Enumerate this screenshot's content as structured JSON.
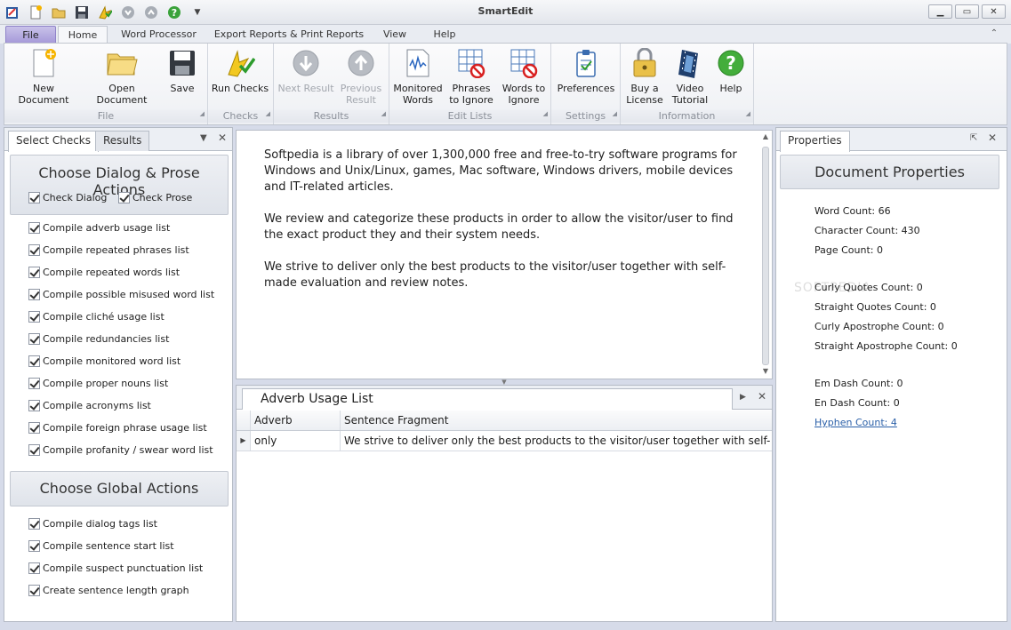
{
  "window": {
    "title": "SmartEdit"
  },
  "qat": {
    "icons": [
      "app-icon",
      "new-icon",
      "open-icon",
      "save-icon",
      "run-icon",
      "next-icon",
      "previous-icon",
      "help-icon",
      "customize-icon"
    ]
  },
  "ribbon_tabs": [
    "File",
    "Home",
    "Word Processor",
    "Export Reports & Print Reports",
    "View",
    "Help"
  ],
  "ribbon": {
    "groups": [
      {
        "label": "File",
        "buttons": [
          "New Document",
          "Open Document",
          "Save"
        ]
      },
      {
        "label": "Checks",
        "buttons": [
          "Run Checks"
        ]
      },
      {
        "label": "Results",
        "buttons": [
          "Next Result",
          "Previous Result"
        ]
      },
      {
        "label": "Edit Lists",
        "buttons": [
          "Monitored Words",
          "Phrases to Ignore",
          "Words to Ignore"
        ]
      },
      {
        "label": "Settings",
        "buttons": [
          "Preferences"
        ]
      },
      {
        "label": "Information",
        "buttons": [
          "Buy a License",
          "Video Tutorial",
          "Help"
        ]
      }
    ],
    "btn": {
      "new_doc": "New Document",
      "open_doc": "Open Document",
      "save": "Save",
      "run_checks": "Run Checks",
      "next_result_1": "Next Result",
      "prev_result_1": "Previous",
      "prev_result_2": "Result",
      "monitored_1": "Monitored",
      "monitored_2": "Words",
      "phrases_1": "Phrases",
      "phrases_2": "to Ignore",
      "words_1": "Words to",
      "words_2": "Ignore",
      "preferences": "Preferences",
      "buy_1": "Buy a",
      "buy_2": "License",
      "video_1": "Video",
      "video_2": "Tutorial",
      "help": "Help"
    }
  },
  "left_panel": {
    "tabs": [
      "Select Checks",
      "Results"
    ],
    "section1_title": "Choose Dialog & Prose Actions",
    "check_dialog": "Check Dialog",
    "check_prose": "Check Prose",
    "options1": [
      "Compile adverb usage list",
      "Compile repeated phrases list",
      "Compile repeated words list",
      "Compile possible misused word list",
      "Compile cliché usage list",
      "Compile redundancies list",
      "Compile monitored word list",
      "Compile proper nouns list",
      "Compile acronyms list",
      "Compile foreign phrase usage list",
      "Compile profanity / swear word list"
    ],
    "section2_title": "Choose Global Actions",
    "options2": [
      "Compile dialog tags list",
      "Compile sentence start list",
      "Compile suspect punctuation list",
      "Create sentence length graph"
    ]
  },
  "editor": {
    "paragraphs": [
      "Softpedia is a library of over 1,300,000 free and free-to-try software programs for Windows and Unix/Linux, games, Mac software, Windows drivers, mobile devices and IT-related articles.",
      "We review and categorize these products in order to allow the visitor/user to find the exact product they and their system needs.",
      "We strive to deliver only the best products to the visitor/user together with self-made evaluation and review notes."
    ]
  },
  "list_panel": {
    "title": "Adverb Usage List",
    "columns": [
      "Adverb",
      "Sentence Fragment"
    ],
    "rows": [
      {
        "adverb": "only",
        "fragment": "We strive to deliver only the best products to the visitor/user together with self-..."
      }
    ]
  },
  "right_panel": {
    "tab": "Properties",
    "title": "Document Properties",
    "stats": [
      "Word Count: 66",
      "Character Count: 430",
      "Page Count: 0",
      "Curly Quotes Count: 0",
      "Straight Quotes Count: 0",
      "Curly Apostrophe Count: 0",
      "Straight Apostrophe Count: 0",
      "Em Dash Count: 0",
      "En Dash Count: 0",
      "Hyphen Count: 4"
    ],
    "watermark": "SOFTPEDIA"
  }
}
